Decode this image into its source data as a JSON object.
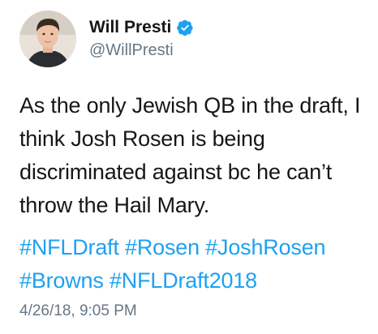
{
  "author": {
    "display_name": "Will Presti",
    "handle": "@WillPresti",
    "verified_icon": "verified-badge-icon",
    "verified_color": "#1da1f2"
  },
  "tweet": {
    "text_lines": [
      "As the only Jewish QB in the draft, I",
      "think Josh Rosen is being",
      "discriminated against bc he can’t",
      "throw the Hail Mary."
    ],
    "hashtag_lines": [
      [
        "#NFLDraft",
        "#Rosen",
        "#JoshRosen"
      ],
      [
        "#Browns",
        "#NFLDraft2018"
      ]
    ],
    "timestamp": "4/26/18, 9:05 PM"
  },
  "colors": {
    "link": "#1da1f2",
    "secondary_text": "#657786",
    "primary_text": "#14171a"
  }
}
